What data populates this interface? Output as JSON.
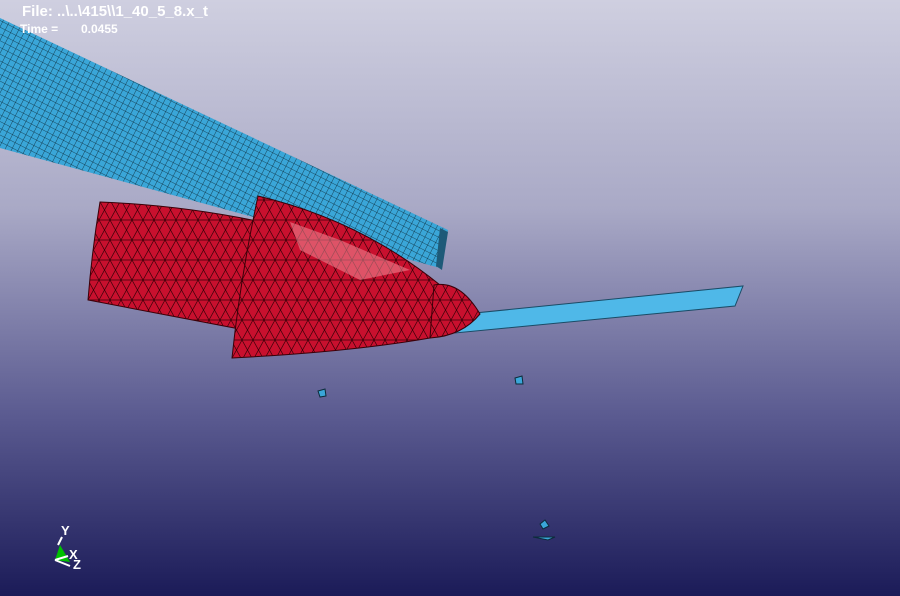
{
  "header": {
    "file_label": "File: ..\\..\\415\\\\1_40_5_8.x_t",
    "time_label": "Time =",
    "time_value": "0.0455"
  },
  "triad": {
    "y": "Y",
    "x": "X",
    "z": "Z"
  },
  "colors": {
    "beam": "#3aa6d8",
    "body": "#c8102e",
    "blade": "#4fb8e8"
  }
}
